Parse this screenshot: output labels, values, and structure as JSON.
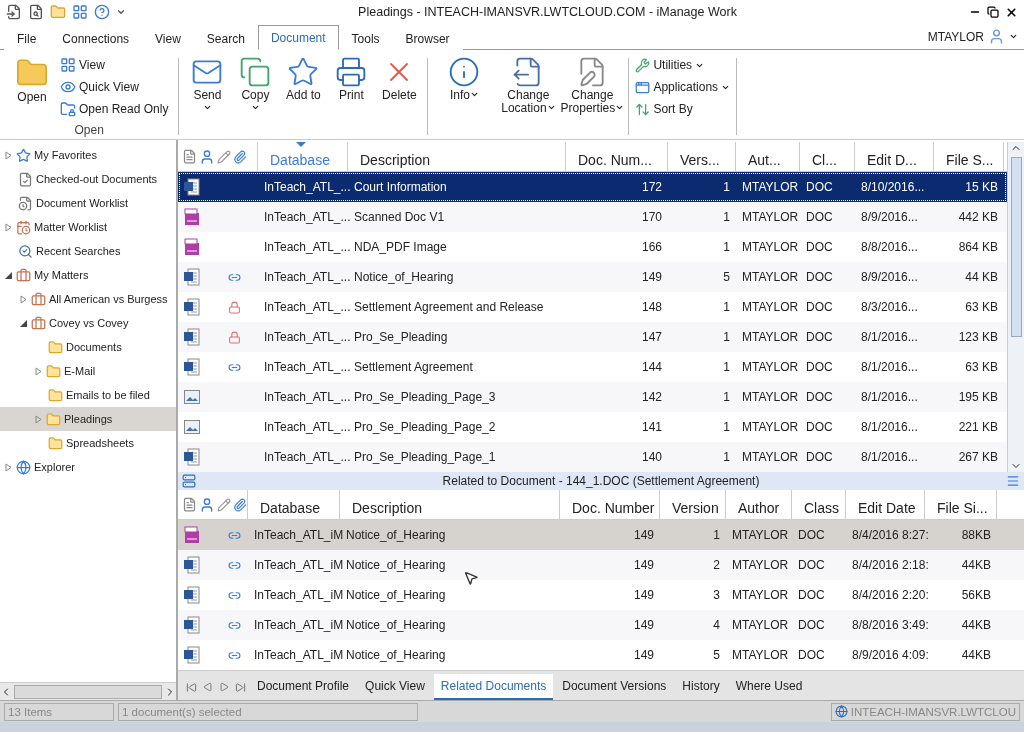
{
  "title_bar": {
    "title": "Pleadings - INTEACH-IMANSVR.LWTCLOUD.COM - iManage Work"
  },
  "menu_tabs": [
    {
      "label": "File",
      "selected": false
    },
    {
      "label": "Connections",
      "selected": false
    },
    {
      "label": "View",
      "selected": false
    },
    {
      "label": "Search",
      "selected": false
    },
    {
      "label": "Document",
      "selected": true
    },
    {
      "label": "Tools",
      "selected": false
    },
    {
      "label": "Browser",
      "selected": false
    }
  ],
  "user": {
    "name": "MTAYLOR"
  },
  "ribbon": {
    "open_group": {
      "button": "Open",
      "items": [
        "View",
        "Quick View",
        "Open Read Only"
      ],
      "label": "Open"
    },
    "actions": [
      {
        "label": "Send",
        "dropdown": true
      },
      {
        "label": "Copy",
        "dropdown": true
      },
      {
        "label": "Add to",
        "dropdown": false
      },
      {
        "label": "Print",
        "dropdown": false
      },
      {
        "label": "Delete",
        "dropdown": false
      }
    ],
    "info_actions": [
      {
        "label": "Info",
        "dropdown": true
      },
      {
        "label": "Change Location",
        "dropdown": true
      },
      {
        "label": "Change Properties",
        "dropdown": true
      }
    ],
    "tools": [
      {
        "label": "Utilities",
        "dropdown": true
      },
      {
        "label": "Applications",
        "dropdown": true
      },
      {
        "label": "Sort By",
        "dropdown": false
      }
    ]
  },
  "tree": [
    {
      "label": "My Favorites",
      "kind": "favorites",
      "expanded": false,
      "selected": false
    },
    {
      "label": "Checked-out Documents",
      "kind": "checkout",
      "selected": false
    },
    {
      "label": "Document Worklist",
      "kind": "worklist",
      "selected": false
    },
    {
      "label": "Matter Worklist",
      "kind": "matterlist",
      "expanded": false,
      "selected": false
    },
    {
      "label": "Recent Searches",
      "kind": "search",
      "selected": false
    },
    {
      "label": "My Matters",
      "kind": "matters",
      "expanded": true,
      "selected": false,
      "children": [
        {
          "label": "All American vs Burgess",
          "kind": "matter",
          "expanded": false,
          "selected": false
        },
        {
          "label": "Covey vs Covey",
          "kind": "matter",
          "expanded": true,
          "selected": false,
          "children": [
            {
              "label": "Documents",
              "kind": "folder",
              "selected": false
            },
            {
              "label": "E-Mail",
              "kind": "folder",
              "expanded": false,
              "selected": false
            },
            {
              "label": "Emails to be filed",
              "kind": "folder",
              "selected": false
            },
            {
              "label": "Pleadings",
              "kind": "folder",
              "expanded": false,
              "selected": true
            },
            {
              "label": "Spreadsheets",
              "kind": "folder",
              "selected": false
            }
          ]
        }
      ]
    },
    {
      "label": "Explorer",
      "kind": "globe",
      "expanded": false,
      "selected": false
    }
  ],
  "documents": {
    "columns": [
      {
        "label": "Database",
        "sorted": true
      },
      {
        "label": "Description",
        "sorted": false
      },
      {
        "label": "Doc. Num...",
        "sorted": false
      },
      {
        "label": "Vers...",
        "sorted": false
      },
      {
        "label": "Aut...",
        "sorted": false
      },
      {
        "label": "Cl...",
        "sorted": false
      },
      {
        "label": "Edit D...",
        "sorted": false
      },
      {
        "label": "File S...",
        "sorted": false
      }
    ],
    "rows": [
      {
        "kind": "word",
        "linked": false,
        "locked": false,
        "database": "InTeach_ATL_...",
        "description": "Court Information",
        "number": "172",
        "version": "1",
        "author": "MTAYLOR",
        "class": "DOC",
        "edit_date": "8/10/2016...",
        "size": "15 KB",
        "selected": true
      },
      {
        "kind": "pdf",
        "linked": false,
        "locked": false,
        "database": "InTeach_ATL_...",
        "description": "Scanned Doc V1",
        "number": "170",
        "version": "1",
        "author": "MTAYLOR",
        "class": "DOC",
        "edit_date": "8/9/2016...",
        "size": "442 KB",
        "selected": false
      },
      {
        "kind": "pdf",
        "linked": false,
        "locked": false,
        "database": "InTeach_ATL_...",
        "description": "NDA_PDF Image",
        "number": "166",
        "version": "1",
        "author": "MTAYLOR",
        "class": "DOC",
        "edit_date": "8/8/2016...",
        "size": "864 KB",
        "selected": false
      },
      {
        "kind": "word",
        "linked": true,
        "locked": false,
        "database": "InTeach_ATL_...",
        "description": "Notice_of_Hearing",
        "number": "149",
        "version": "5",
        "author": "MTAYLOR",
        "class": "DOC",
        "edit_date": "8/9/2016...",
        "size": "44 KB",
        "selected": false
      },
      {
        "kind": "word",
        "linked": false,
        "locked": true,
        "database": "InTeach_ATL_...",
        "description": "Settlement Agreement and Release",
        "number": "148",
        "version": "1",
        "author": "MTAYLOR",
        "class": "DOC",
        "edit_date": "8/3/2016...",
        "size": "63 KB",
        "selected": false
      },
      {
        "kind": "word",
        "linked": false,
        "locked": true,
        "database": "InTeach_ATL_...",
        "description": "Pro_Se_Pleading",
        "number": "147",
        "version": "1",
        "author": "MTAYLOR",
        "class": "DOC",
        "edit_date": "8/1/2016...",
        "size": "123 KB",
        "selected": false
      },
      {
        "kind": "word",
        "linked": true,
        "locked": false,
        "database": "InTeach_ATL_...",
        "description": "Settlement Agreement",
        "number": "144",
        "version": "1",
        "author": "MTAYLOR",
        "class": "DOC",
        "edit_date": "8/1/2016...",
        "size": "63 KB",
        "selected": false
      },
      {
        "kind": "image",
        "linked": false,
        "locked": false,
        "database": "InTeach_ATL_...",
        "description": "Pro_Se_Pleading_Page_3",
        "number": "142",
        "version": "1",
        "author": "MTAYLOR",
        "class": "DOC",
        "edit_date": "8/1/2016...",
        "size": "195 KB",
        "selected": false
      },
      {
        "kind": "image",
        "linked": false,
        "locked": false,
        "database": "InTeach_ATL_...",
        "description": "Pro_Se_Pleading_Page_2",
        "number": "141",
        "version": "1",
        "author": "MTAYLOR",
        "class": "DOC",
        "edit_date": "8/1/2016...",
        "size": "221 KB",
        "selected": false
      },
      {
        "kind": "word",
        "linked": false,
        "locked": false,
        "database": "InTeach_ATL_...",
        "description": "Pro_Se_Pleading_Page_1",
        "number": "140",
        "version": "1",
        "author": "MTAYLOR",
        "class": "DOC",
        "edit_date": "8/1/2016...",
        "size": "267 KB",
        "selected": false
      }
    ]
  },
  "related": {
    "title": "Related to Document - 144_1.DOC (Settlement Agreement)",
    "columns": [
      {
        "label": "Database",
        "sorted": false
      },
      {
        "label": "Description",
        "sorted": false
      },
      {
        "label": "Doc. Number",
        "sorted": false
      },
      {
        "label": "Version",
        "sorted": false
      },
      {
        "label": "Author",
        "sorted": false
      },
      {
        "label": "Class",
        "sorted": false
      },
      {
        "label": "Edit Date",
        "sorted": false
      },
      {
        "label": "File Si...",
        "sorted": false
      }
    ],
    "rows": [
      {
        "kind": "pdf",
        "linked": true,
        "locked": false,
        "database": "InTeach_ATL_iM",
        "description": "Notice_of_Hearing",
        "number": "149",
        "version": "1",
        "author": "MTAYLOR",
        "class": "DOC",
        "edit_date": "8/4/2016 8:27:",
        "size": "88KB",
        "selected": true
      },
      {
        "kind": "word",
        "linked": true,
        "locked": false,
        "database": "InTeach_ATL_iM",
        "description": "Notice_of_Hearing",
        "number": "149",
        "version": "2",
        "author": "MTAYLOR",
        "class": "DOC",
        "edit_date": "8/4/2016 2:18:",
        "size": "44KB",
        "selected": false
      },
      {
        "kind": "word",
        "linked": true,
        "locked": false,
        "database": "InTeach_ATL_iM",
        "description": "Notice_of_Hearing",
        "number": "149",
        "version": "3",
        "author": "MTAYLOR",
        "class": "DOC",
        "edit_date": "8/4/2016 2:20:",
        "size": "56KB",
        "selected": false
      },
      {
        "kind": "word",
        "linked": true,
        "locked": false,
        "database": "InTeach_ATL_iM",
        "description": "Notice_of_Hearing",
        "number": "149",
        "version": "4",
        "author": "MTAYLOR",
        "class": "DOC",
        "edit_date": "8/8/2016 3:49:",
        "size": "44KB",
        "selected": false
      },
      {
        "kind": "word",
        "linked": true,
        "locked": false,
        "database": "InTeach_ATL_iM",
        "description": "Notice_of_Hearing",
        "number": "149",
        "version": "5",
        "author": "MTAYLOR",
        "class": "DOC",
        "edit_date": "8/9/2016 4:09:",
        "size": "44KB",
        "selected": false
      }
    ]
  },
  "bottom_tabs": [
    {
      "label": "Document Profile",
      "selected": false
    },
    {
      "label": "Quick View",
      "selected": false
    },
    {
      "label": "Related Documents",
      "selected": true
    },
    {
      "label": "Document Versions",
      "selected": false
    },
    {
      "label": "History",
      "selected": false
    },
    {
      "label": "Where Used",
      "selected": false
    }
  ],
  "status_bar": {
    "count": "13 Items",
    "selection": "1 document(s) selected",
    "server": "INTEACH-IMANSVR.LWTCLOU"
  }
}
